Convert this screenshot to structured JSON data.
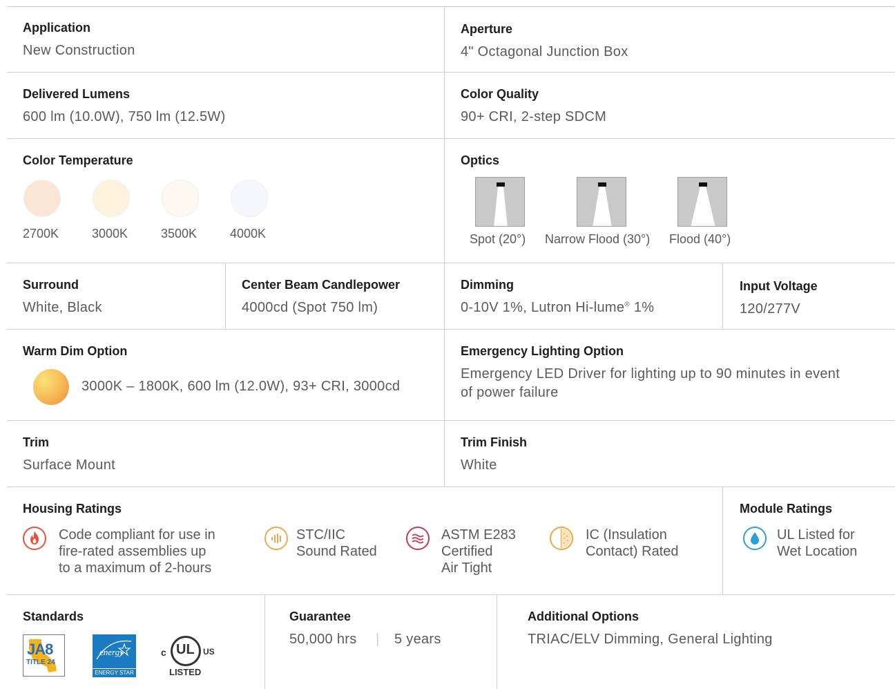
{
  "application": {
    "label": "Application",
    "value": "New Construction"
  },
  "aperture": {
    "label": "Aperture",
    "value": "4\" Octagonal Junction Box"
  },
  "delivered_lumens": {
    "label": "Delivered Lumens",
    "value": "600 lm (10.0W), 750 lm (12.5W)"
  },
  "color_quality": {
    "label": "Color Quality",
    "value": "90+ CRI, 2-step SDCM"
  },
  "color_temperature": {
    "label": "Color Temperature",
    "options": [
      {
        "name": "2700K",
        "color": "#fbe6d6"
      },
      {
        "name": "3000K",
        "color": "#fdf3dd"
      },
      {
        "name": "3500K",
        "color": "#fdf9f2"
      },
      {
        "name": "4000K",
        "color": "#f6f7fd"
      }
    ]
  },
  "optics": {
    "label": "Optics",
    "options": [
      {
        "name": "Spot (20°)",
        "beam_angle": 20
      },
      {
        "name": "Narrow Flood (30°)",
        "beam_angle": 30
      },
      {
        "name": "Flood (40°)",
        "beam_angle": 40
      }
    ]
  },
  "surround": {
    "label": "Surround",
    "value": "White, Black"
  },
  "cbcp": {
    "label": "Center Beam Candlepower",
    "value": "4000cd (Spot 750 lm)"
  },
  "dimming": {
    "label": "Dimming",
    "value_pre": "0-10V 1%, Lutron Hi-lume",
    "value_sup": "®",
    "value_post": " 1%"
  },
  "input_voltage": {
    "label": "Input Voltage",
    "value": "120/277V"
  },
  "warm_dim": {
    "label": "Warm Dim Option",
    "value": "3000K – 1800K, 600 lm (12.0W), 93+ CRI, 3000cd"
  },
  "emergency": {
    "label": "Emergency Lighting Option",
    "line1": "Emergency LED Driver for lighting up to 90 minutes in event",
    "line2": "of power failure"
  },
  "trim": {
    "label": "Trim",
    "value": "Surface Mount"
  },
  "trim_finish": {
    "label": "Trim Finish",
    "value": "White"
  },
  "housing_ratings": {
    "label": "Housing Ratings",
    "items": [
      {
        "icon": "flame-icon",
        "color": "#e8503a",
        "lines": [
          "Code compliant for use in",
          "fire-rated assemblies up",
          "to a maximum of 2-hours"
        ]
      },
      {
        "icon": "sound-wave-icon",
        "color": "#e9a94a",
        "lines": [
          "STC/IIC",
          "Sound Rated"
        ]
      },
      {
        "icon": "air-wave-icon",
        "color": "#c0395a",
        "lines": [
          "ASTM E283",
          "Certified",
          "Air Tight"
        ]
      },
      {
        "icon": "insulation-icon",
        "color": "#f0a63a",
        "lines": [
          "IC (Insulation",
          "Contact) Rated"
        ]
      }
    ]
  },
  "module_ratings": {
    "label": "Module Ratings",
    "items": [
      {
        "icon": "water-drop-icon",
        "color": "#2a9fd8",
        "lines": [
          "UL Listed for",
          "Wet Location"
        ]
      }
    ]
  },
  "standards": {
    "label": "Standards",
    "logos": [
      {
        "icon": "ja8-title24-logo",
        "text1": "JA8",
        "text2": "TITLE 24"
      },
      {
        "icon": "energy-star-logo",
        "text1": "energy",
        "text2": "ENERGY STAR"
      },
      {
        "icon": "ul-listed-logo",
        "text1": "UL",
        "text2": "LISTED",
        "left": "c",
        "right": "US"
      }
    ]
  },
  "guarantee": {
    "label": "Guarantee",
    "hours": "50,000 hrs",
    "separator": "|",
    "years": "5 years"
  },
  "additional_options": {
    "label": "Additional Options",
    "value": "TRIAC/ELV Dimming, General Lighting"
  }
}
